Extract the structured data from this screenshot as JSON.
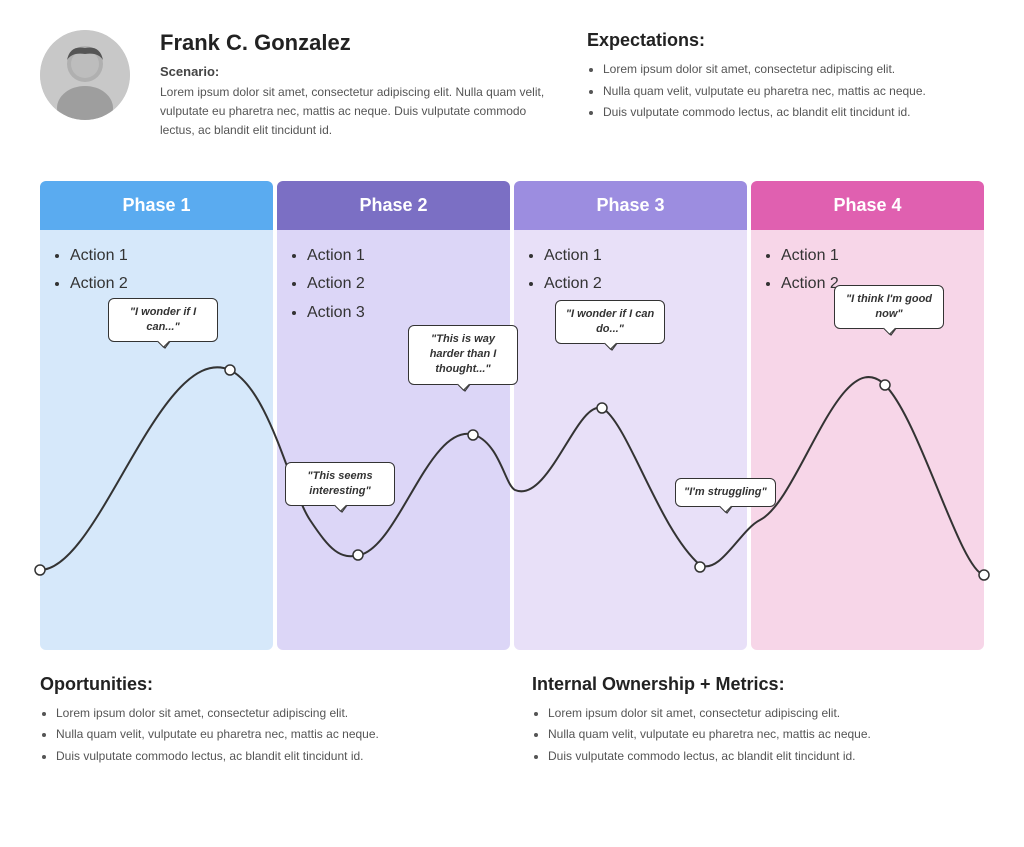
{
  "header": {
    "name": "Frank C. Gonzalez",
    "scenario_label": "Scenario:",
    "scenario_text": "Lorem ipsum dolor sit amet, consectetur adipiscing elit. Nulla quam velit, vulputate eu pharetra nec, mattis ac neque. Duis vulputate commodo lectus, ac blandit elit tincidunt id.",
    "expectations_label": "Expectations:",
    "expectations": [
      "Lorem ipsum dolor sit amet, consectetur adipiscing elit.",
      "Nulla quam velit, vulputate eu pharetra nec, mattis ac neque.",
      "Duis vulputate commodo lectus, ac blandit elit tincidunt id."
    ]
  },
  "phases": [
    {
      "label": "Phase 1",
      "color_class": "p1",
      "actions": [
        "Action 1",
        "Action 2"
      ],
      "bubble": {
        "text": "\"I wonder if I can...\"",
        "position": "top"
      }
    },
    {
      "label": "Phase 2",
      "color_class": "p2",
      "actions": [
        "Action 1",
        "Action 2",
        "Action 3"
      ],
      "bubbles": [
        {
          "text": "\"This seems interesting\"",
          "position": "bottom"
        },
        {
          "text": "\"This is way harder than I thought...\"",
          "position": "top"
        }
      ]
    },
    {
      "label": "Phase 3",
      "color_class": "p3",
      "actions": [
        "Action 1",
        "Action 2"
      ],
      "bubbles": [
        {
          "text": "\"I wonder if I can do...\"",
          "position": "top"
        },
        {
          "text": "\"I'm struggling\"",
          "position": "bottom"
        }
      ]
    },
    {
      "label": "Phase 4",
      "color_class": "p4",
      "actions": [
        "Action 1",
        "Action 2"
      ],
      "bubble": {
        "text": "\"I think I'm good now\"",
        "position": "top"
      }
    }
  ],
  "bottom": {
    "opportunities_label": "Oportunities:",
    "opportunities": [
      "Lorem ipsum dolor sit amet, consectetur adipiscing elit.",
      "Nulla quam velit, vulputate eu pharetra nec, mattis ac neque.",
      "Duis vulputate commodo lectus, ac blandit elit tincidunt id."
    ],
    "metrics_label": "Internal Ownership + Metrics:",
    "metrics": [
      "Lorem ipsum dolor sit amet, consectetur adipiscing elit.",
      "Nulla quam velit, vulputate eu pharetra nec, mattis ac neque.",
      "Duis vulputate commodo lectus, ac blandit elit tincidunt id."
    ]
  }
}
